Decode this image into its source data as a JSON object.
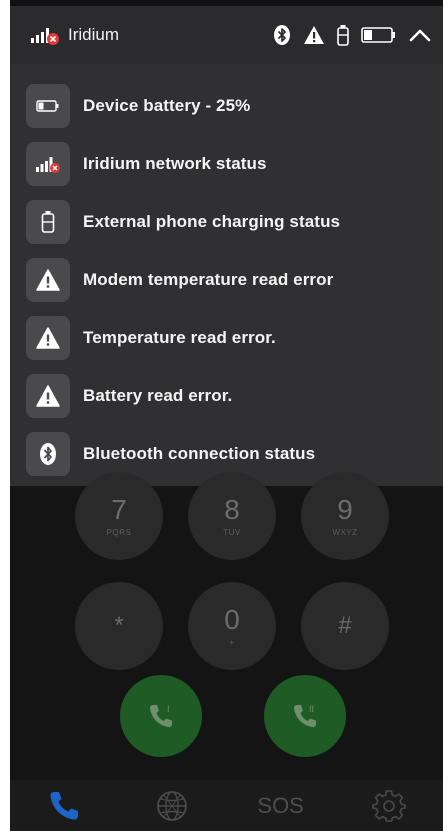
{
  "status_bar": {
    "network": "Iridium",
    "icons": [
      "bluetooth-icon",
      "warning-icon",
      "phone-charging-icon",
      "battery-icon",
      "chevron-up-icon"
    ]
  },
  "status_panel": {
    "items": [
      {
        "icon": "battery-icon",
        "label": "Device battery - 25%"
      },
      {
        "icon": "signal-icon",
        "label": "Iridium network status"
      },
      {
        "icon": "phone-charging-icon",
        "label": "External phone charging status"
      },
      {
        "icon": "warning-icon",
        "label": "Modem temperature read error"
      },
      {
        "icon": "warning-icon",
        "label": "Temperature read error."
      },
      {
        "icon": "warning-icon",
        "label": "Battery read error."
      },
      {
        "icon": "bluetooth-icon",
        "label": "Bluetooth connection status"
      }
    ]
  },
  "keypad": {
    "keys": [
      {
        "digit": "7",
        "letters": "PQRS"
      },
      {
        "digit": "8",
        "letters": "TUV"
      },
      {
        "digit": "9",
        "letters": "WXYZ"
      },
      {
        "digit": "*",
        "letters": ""
      },
      {
        "digit": "0",
        "letters": "+"
      },
      {
        "digit": "#",
        "letters": ""
      }
    ],
    "call_buttons": [
      {
        "icon": "phone-line-1-icon",
        "line": "I"
      },
      {
        "icon": "phone-line-2-icon",
        "line": "II"
      }
    ]
  },
  "tab_bar": {
    "sos_label": "SOS",
    "tabs": [
      "phone-icon",
      "globe-icon",
      "sos",
      "settings-icon"
    ]
  },
  "colors": {
    "status_bar_bg": "#2b2b2d",
    "panel_bg": "#303032",
    "icon_tile_bg": "#4a4a4d",
    "alert_red": "#e53935",
    "active_tab_blue": "#1e63c7",
    "call_green": "#1f5b25"
  }
}
